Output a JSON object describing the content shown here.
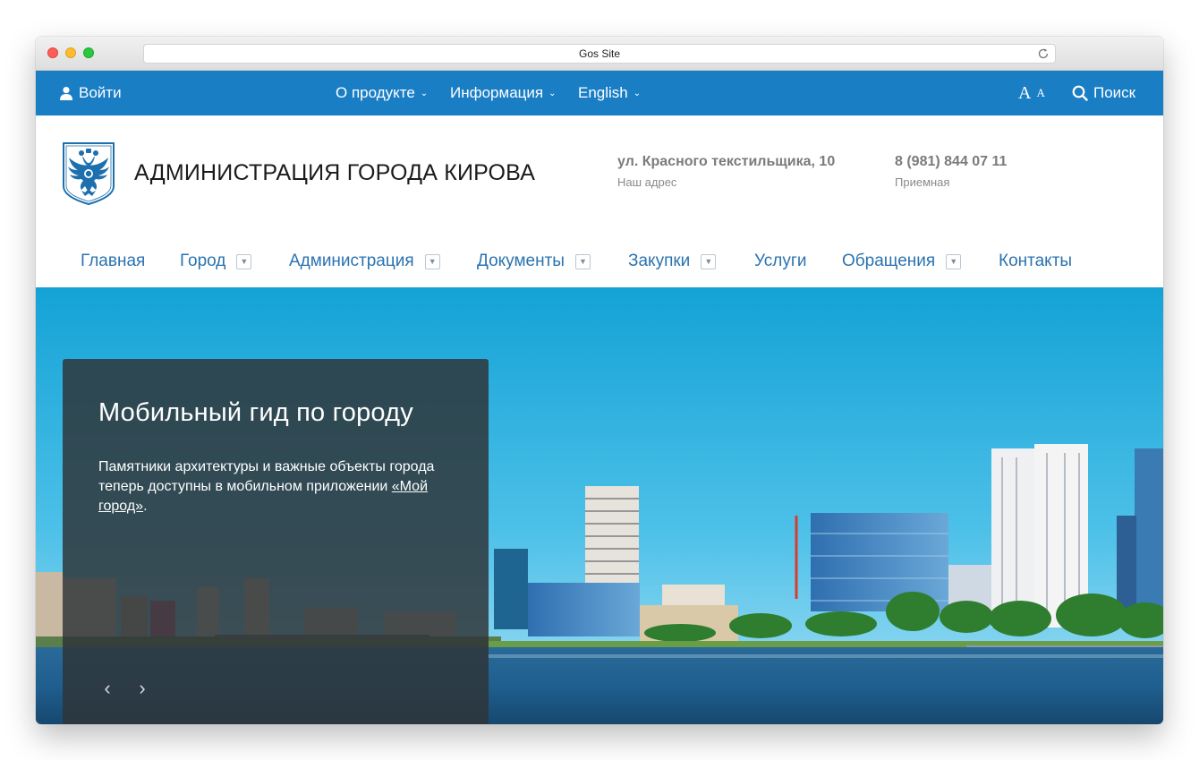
{
  "browser": {
    "url_title": "Gos Site"
  },
  "topbar": {
    "login": "Войти",
    "nav": [
      {
        "label": "О продукте"
      },
      {
        "label": "Информация"
      },
      {
        "label": "English"
      }
    ],
    "font_size_big": "A",
    "font_size_small": "A",
    "search": "Поиск",
    "color": "#1a7ec5"
  },
  "header": {
    "title": "АДМИНИСТРАЦИЯ ГОРОДА КИРОВА",
    "address": "ул. Красного текстильщика, 10",
    "address_label": "Наш адрес",
    "phone": "8 (981) 844 07 11",
    "phone_label": "Приемная"
  },
  "mainnav": [
    {
      "label": "Главная",
      "dropdown": false
    },
    {
      "label": "Город",
      "dropdown": true
    },
    {
      "label": "Администрация",
      "dropdown": true
    },
    {
      "label": "Документы",
      "dropdown": true
    },
    {
      "label": "Закупки",
      "dropdown": true
    },
    {
      "label": "Услуги",
      "dropdown": false
    },
    {
      "label": "Обращения",
      "dropdown": true
    },
    {
      "label": "Контакты",
      "dropdown": false
    }
  ],
  "hero": {
    "title": "Мобильный гид по городу",
    "text": "Памятники архитектуры и важные объекты города теперь доступны в мобильном приложении ",
    "link": "«Мой город»",
    "text_end": ".",
    "prev": "‹",
    "next": "›"
  },
  "icons": [
    "user-icon",
    "chevron-down-icon",
    "search-icon",
    "emblem-icon",
    "reload-icon",
    "chevron-left-icon",
    "chevron-right-icon"
  ]
}
